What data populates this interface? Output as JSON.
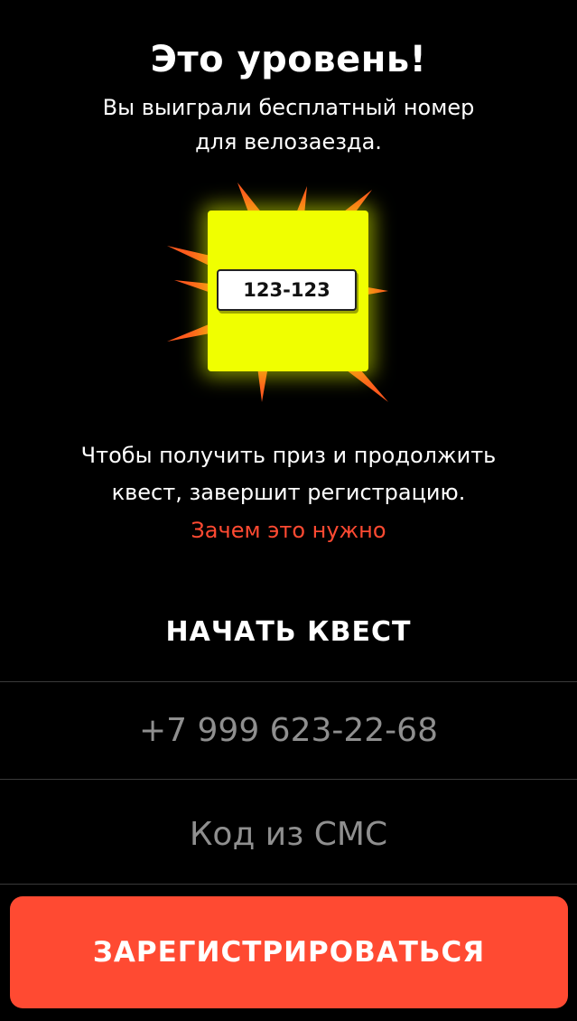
{
  "header": {
    "title": "Это уровень!",
    "subtitle_line1": "Вы выиграли бесплатный номер",
    "subtitle_line2": "для велозаезда."
  },
  "prize": {
    "number": "123-123",
    "card_color": "#f0ff00",
    "burst_color": "#ff5a1e"
  },
  "info": {
    "line1": "Чтобы получить приз и продолжить",
    "line2": "квест, завершит регистрацию.",
    "why_link": "Зачем это нужно"
  },
  "form": {
    "heading": "НАЧАТЬ КВЕСТ",
    "phone_value": "+7 999 623-22-68",
    "sms_placeholder": "Код из СМС",
    "submit_label": "ЗАРЕГИСТРИРОВАТЬСЯ"
  },
  "colors": {
    "background": "#000000",
    "accent": "#ff4a32",
    "muted_text": "#8f8f8f"
  }
}
